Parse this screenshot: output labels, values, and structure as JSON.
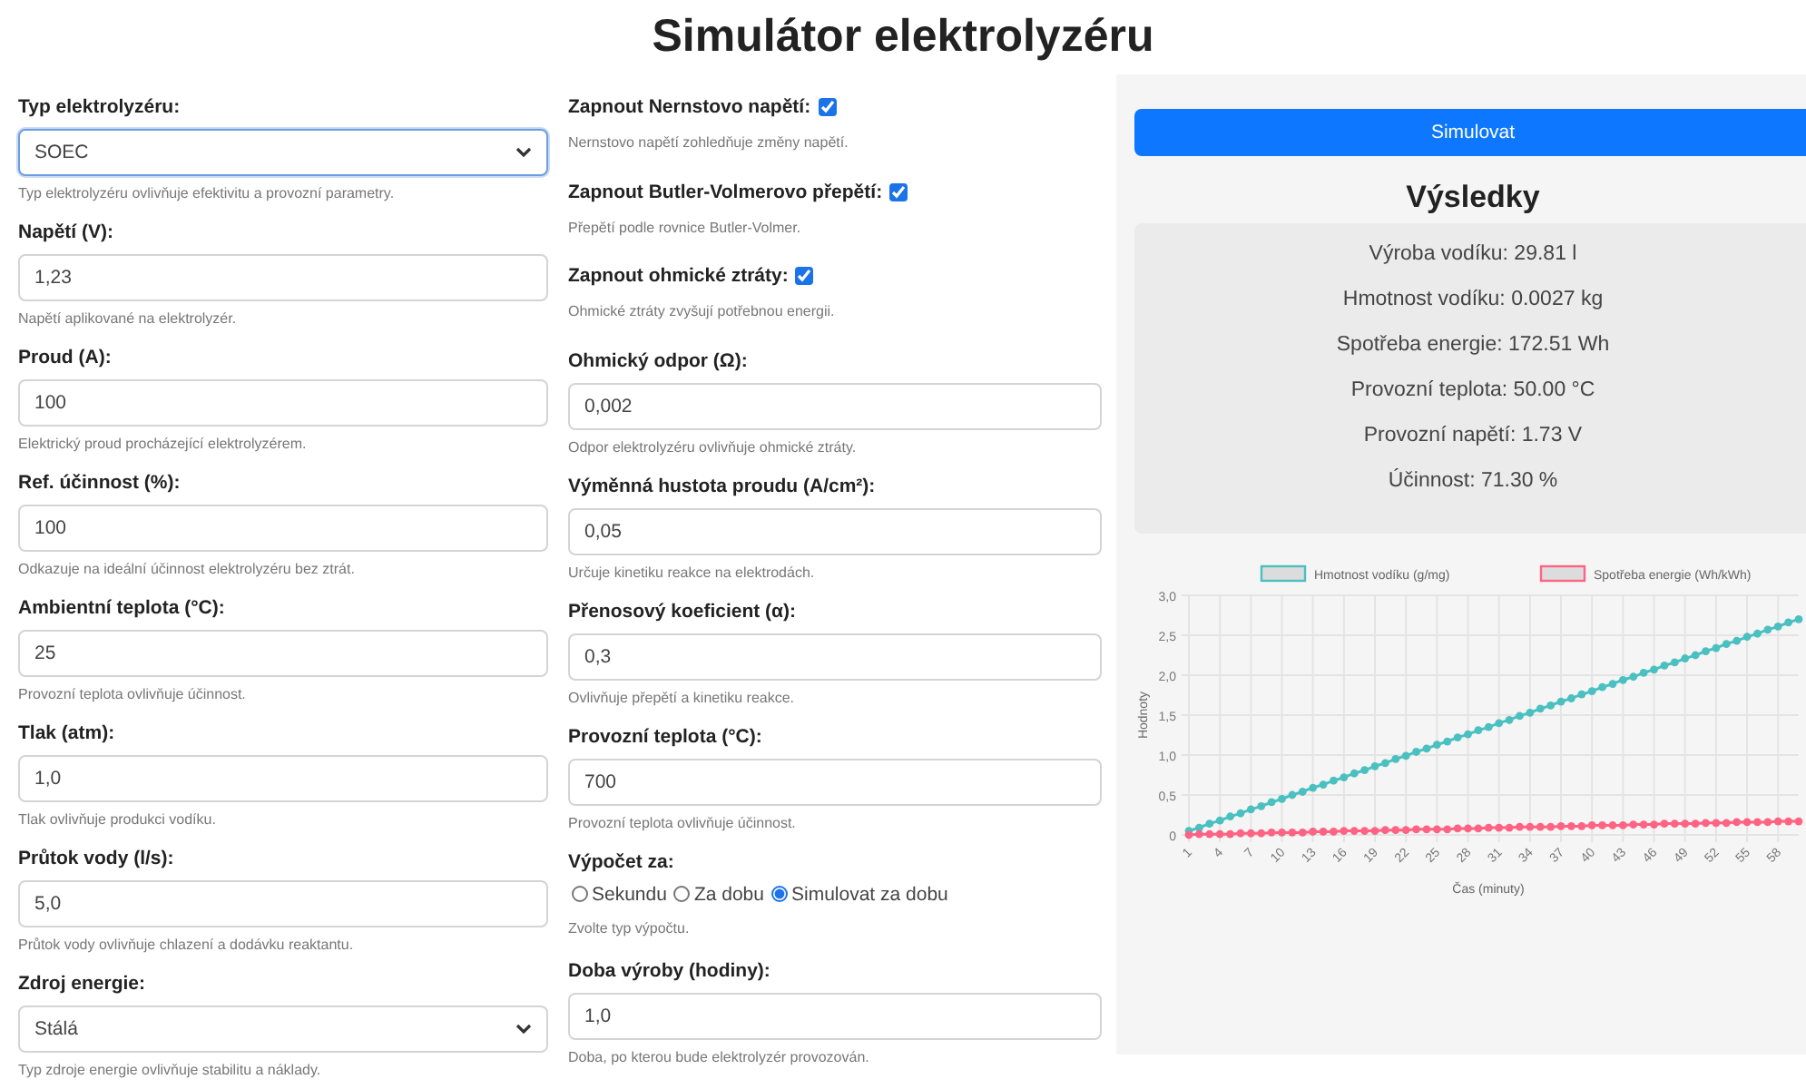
{
  "title": "Simulátor elektrolyzéru",
  "columns": [
    [
      {
        "kind": "select",
        "label": "Typ elektrolyzéru:",
        "value": "SOEC",
        "focused": true,
        "help": "Typ elektrolyzéru ovlivňuje efektivitu a provozní parametry."
      },
      {
        "kind": "input",
        "label": "Napětí (V):",
        "value": "1,23",
        "help": "Napětí aplikované na elektrolyzér."
      },
      {
        "kind": "input",
        "label": "Proud (A):",
        "value": "100",
        "help": "Elektrický proud procházející elektrolyzérem."
      },
      {
        "kind": "input",
        "label": "Ref. účinnost (%):",
        "value": "100",
        "help": "Odkazuje na ideální účinnost elektrolyzéru bez ztrát."
      },
      {
        "kind": "input",
        "label": "Ambientní teplota (°C):",
        "value": "25",
        "help": "Provozní teplota ovlivňuje účinnost."
      },
      {
        "kind": "input",
        "label": "Tlak (atm):",
        "value": "1,0",
        "help": "Tlak ovlivňuje produkci vodíku."
      },
      {
        "kind": "input",
        "label": "Průtok vody (l/s):",
        "value": "5,0",
        "help": "Průtok vody ovlivňuje chlazení a dodávku reaktantu."
      },
      {
        "kind": "select",
        "label": "Zdroj energie:",
        "value": "Stálá",
        "focused": false,
        "help": "Typ zdroje energie ovlivňuje stabilitu a náklady."
      }
    ],
    [
      {
        "kind": "checkbox",
        "label": "Zapnout Nernstovo napětí:",
        "checked": true,
        "help": "Nernstovo napětí zohledňuje změny napětí."
      },
      {
        "kind": "checkbox",
        "label": "Zapnout Butler-Volmerovo přepětí:",
        "checked": true,
        "help": "Přepětí podle rovnice Butler-Volmer."
      },
      {
        "kind": "checkbox",
        "label": "Zapnout ohmické ztráty:",
        "checked": true,
        "help": "Ohmické ztráty zvyšují potřebnou energii."
      },
      {
        "kind": "input",
        "label": "Ohmický odpor (Ω):",
        "value": "0,002",
        "help": "Odpor elektrolyzéru ovlivňuje ohmické ztráty."
      },
      {
        "kind": "input",
        "label": "Výměnná hustota proudu (A/cm²):",
        "value": "0,05",
        "help": "Určuje kinetiku reakce na elektrodách."
      },
      {
        "kind": "input",
        "label": "Přenosový koeficient (α):",
        "value": "0,3",
        "help": "Ovlivňuje přepětí a kinetiku reakce."
      },
      {
        "kind": "input",
        "label": "Provozní teplota (°C):",
        "value": "700",
        "help": "Provozní teplota ovlivňuje účinnost."
      },
      {
        "kind": "radio",
        "label": "Výpočet za:",
        "options": [
          {
            "label": "Sekundu",
            "selected": false
          },
          {
            "label": "Za dobu",
            "selected": false
          },
          {
            "label": "Simulovat za dobu",
            "selected": true
          }
        ],
        "help": "Zvolte typ výpočtu."
      },
      {
        "kind": "input",
        "label": "Doba výroby (hodiny):",
        "value": "1,0",
        "help": "Doba, po kterou bude elektrolyzér provozován."
      }
    ]
  ],
  "simulate_button": {
    "label": "Simulovat"
  },
  "results": {
    "title": "Výsledky",
    "lines": [
      "Výroba vodíku: 29.81 l",
      "Hmotnost vodíku: 0.0027 kg",
      "Spotřeba energie: 172.51 Wh",
      "Provozní teplota: 50.00 °C",
      "Provozní napětí: 1.73 V",
      "Účinnost: 71.30 %"
    ]
  },
  "chart": {
    "chart_data": {
      "type": "line",
      "xlabel": "Čas (minuty)",
      "ylabel": "Hodnoty",
      "x": [
        1,
        2,
        3,
        4,
        5,
        6,
        7,
        8,
        9,
        10,
        11,
        12,
        13,
        14,
        15,
        16,
        17,
        18,
        19,
        20,
        21,
        22,
        23,
        24,
        25,
        26,
        27,
        28,
        29,
        30,
        31,
        32,
        33,
        34,
        35,
        36,
        37,
        38,
        39,
        40,
        41,
        42,
        43,
        44,
        45,
        46,
        47,
        48,
        49,
        50,
        51,
        52,
        53,
        54,
        55,
        56,
        57,
        58,
        59,
        60
      ],
      "xticks": [
        1,
        4,
        7,
        10,
        13,
        16,
        19,
        22,
        25,
        28,
        31,
        34,
        37,
        40,
        43,
        46,
        49,
        52,
        55,
        58
      ],
      "grid": true,
      "legend": true,
      "xlim": [
        1,
        60
      ],
      "ylim": [
        0,
        3
      ],
      "yticks": [
        {
          "value": 0,
          "label": "0"
        },
        {
          "value": 0.5,
          "label": "0,5"
        },
        {
          "value": 1,
          "label": "1,0"
        },
        {
          "value": 1.5,
          "label": "1,5"
        },
        {
          "value": 2,
          "label": "2,0"
        },
        {
          "value": 2.5,
          "label": "2,5"
        },
        {
          "value": 3,
          "label": "3,0"
        }
      ],
      "series": [
        {
          "name": "Hmotnost vodíku (g/mg)",
          "color": "#4bc0c0",
          "marker": "circle",
          "values": [
            0.05,
            0.09,
            0.14,
            0.18,
            0.23,
            0.27,
            0.32,
            0.36,
            0.41,
            0.45,
            0.5,
            0.54,
            0.59,
            0.63,
            0.68,
            0.72,
            0.77,
            0.81,
            0.86,
            0.9,
            0.95,
            0.99,
            1.04,
            1.08,
            1.13,
            1.17,
            1.22,
            1.26,
            1.31,
            1.35,
            1.4,
            1.44,
            1.49,
            1.53,
            1.58,
            1.62,
            1.67,
            1.71,
            1.76,
            1.8,
            1.85,
            1.89,
            1.94,
            1.98,
            2.03,
            2.07,
            2.12,
            2.16,
            2.21,
            2.25,
            2.3,
            2.34,
            2.39,
            2.43,
            2.48,
            2.52,
            2.57,
            2.61,
            2.66,
            2.7
          ]
        },
        {
          "name": "Spotřeba energie (Wh/kWh)",
          "color": "#ff6384",
          "marker": "circle",
          "values": [
            0,
            0.01,
            0.01,
            0.01,
            0.01,
            0.02,
            0.02,
            0.02,
            0.03,
            0.03,
            0.03,
            0.03,
            0.04,
            0.04,
            0.04,
            0.05,
            0.05,
            0.05,
            0.05,
            0.06,
            0.06,
            0.06,
            0.07,
            0.07,
            0.07,
            0.07,
            0.08,
            0.08,
            0.08,
            0.09,
            0.09,
            0.09,
            0.1,
            0.1,
            0.1,
            0.1,
            0.11,
            0.11,
            0.11,
            0.12,
            0.12,
            0.12,
            0.12,
            0.13,
            0.13,
            0.13,
            0.14,
            0.14,
            0.14,
            0.14,
            0.15,
            0.15,
            0.15,
            0.16,
            0.16,
            0.16,
            0.16,
            0.17,
            0.17,
            0.17
          ]
        }
      ]
    }
  }
}
